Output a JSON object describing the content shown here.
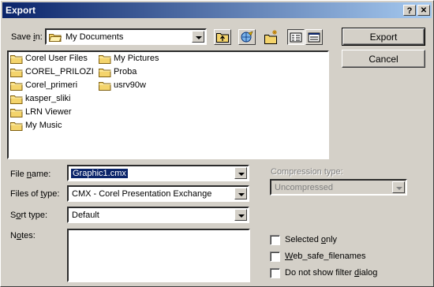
{
  "window": {
    "title": "Export",
    "help_button": "?",
    "close_button": "✕"
  },
  "save_in": {
    "label": "Save in:",
    "mnemonic": "i",
    "value": "My Documents"
  },
  "files": [
    "Corel User Files",
    "My Pictures",
    "COREL_PRILOZI",
    "Proba",
    "Corel_primeri",
    "usrv90w",
    "kasper_sliki",
    "LRN Viewer",
    "My Music"
  ],
  "file_name": {
    "label": "File name:",
    "value": "Graphic1.cmx"
  },
  "files_of_type": {
    "label": "Files of type:",
    "value": "CMX - Corel Presentation Exchange"
  },
  "sort_type": {
    "label": "Sort type:",
    "value": "Default"
  },
  "notes": {
    "label": "Notes:",
    "value": ""
  },
  "compression": {
    "label": "Compression type:",
    "value": "Uncompressed",
    "enabled": false
  },
  "buttons": {
    "export": "Export",
    "cancel": "Cancel"
  },
  "options": [
    {
      "label": "Selected only",
      "checked": false
    },
    {
      "label": "Web_safe_filenames",
      "checked": false
    },
    {
      "label": "Do not show filter dialog",
      "checked": false
    }
  ],
  "colors": {
    "title_start": "#0a246a",
    "title_end": "#a6caf0",
    "folder": "#f4d46c",
    "selection": "#0a246a",
    "face": "#d4d0c8"
  }
}
